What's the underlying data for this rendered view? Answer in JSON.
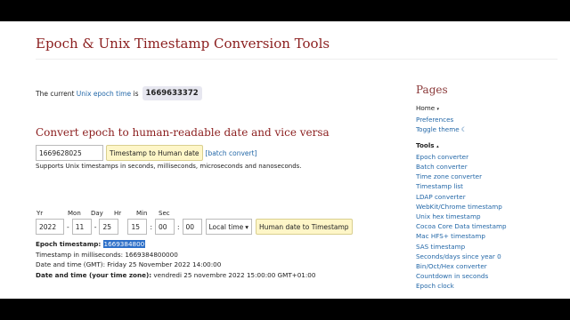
{
  "site": {
    "title": "Epoch & Unix Timestamp Conversion Tools"
  },
  "current": {
    "prefix": "The current",
    "link": "Unix epoch time",
    "suffix": "is",
    "value": "1669633372"
  },
  "converter": {
    "heading": "Convert epoch to human-readable date and vice versa",
    "input_value": "1669628025",
    "to_human_button": "Timestamp to Human date",
    "batch_link": "[batch convert]",
    "note": "Supports Unix timestamps in seconds, milliseconds, microseconds and nanoseconds."
  },
  "human_form": {
    "labels": {
      "yr": "Yr",
      "mon": "Mon",
      "day": "Day",
      "hr": "Hr",
      "min": "Min",
      "sec": "Sec"
    },
    "values": {
      "yr": "2022",
      "mon": "11",
      "day": "25",
      "hr": "15",
      "min": "00",
      "sec": "00"
    },
    "dash": "-",
    "colon": ":",
    "timezone": "Local time",
    "to_timestamp_button": "Human date to Timestamp"
  },
  "results": {
    "epoch_label": "Epoch timestamp:",
    "epoch_value": "1669384800",
    "ms_line": "Timestamp in milliseconds: 1669384800000",
    "gmt_line": "Date and time (GMT): Friday 25 November 2022 14:00:00",
    "tz_label": "Date and time (your time zone):",
    "tz_value": "vendredi 25 novembre 2022 15:00:00 GMT+01:00"
  },
  "sidebar": {
    "title": "Pages",
    "pages": [
      "Home",
      "Preferences",
      "Toggle theme"
    ],
    "tools_label": "Tools",
    "tools": [
      "Epoch converter",
      "Batch converter",
      "Time zone converter",
      "Timestamp list",
      "LDAP converter",
      "WebKit/Chrome timestamp",
      "Unix hex timestamp",
      "Cocoa Core Data timestamp",
      "Mac HFS+ timestamp",
      "SAS timestamp",
      "Seconds/days since year 0",
      "Bin/Oct/Hex converter",
      "Countdown in seconds",
      "Epoch clock"
    ]
  }
}
